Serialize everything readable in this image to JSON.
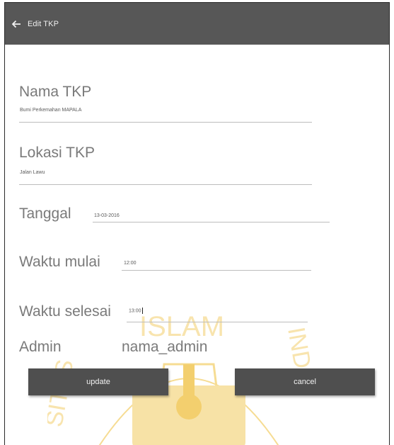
{
  "appbar": {
    "title": "Edit TKP",
    "back_icon": "arrow-left-icon"
  },
  "form": {
    "nama_tkp": {
      "label": "Nama TKP",
      "value": "Bumi Perkemahan MAPALA"
    },
    "lokasi_tkp": {
      "label": "Lokasi TKP",
      "value": "Jalan Lawu"
    },
    "tanggal": {
      "label": "Tanggal",
      "value": "13-03-2016"
    },
    "waktu_mulai": {
      "label": "Waktu mulai",
      "value": "12:00"
    },
    "waktu_selesai": {
      "label": "Waktu selesai",
      "value": "13:00"
    },
    "admin": {
      "label": "Admin",
      "value": "nama_admin"
    }
  },
  "buttons": {
    "update": "update",
    "cancel": "cancel"
  },
  "watermark": {
    "text_top": "ISLAM",
    "text_left": "SITAS",
    "text_right": "INDO"
  },
  "colors": {
    "appbar": "#575757",
    "button": "#4f4f4f",
    "watermark": "#f3d27a"
  }
}
